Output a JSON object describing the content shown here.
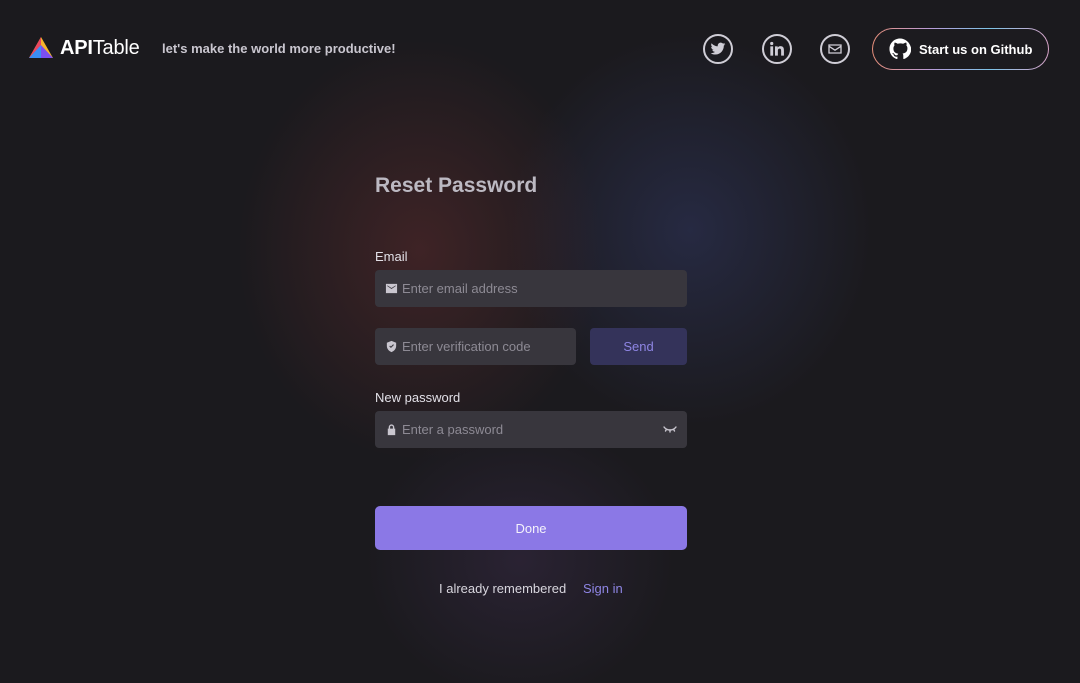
{
  "header": {
    "brand_bold": "API",
    "brand_light": "Table",
    "tagline": "let's make the world more productive!",
    "github_label": "Start us on Github"
  },
  "icons": {
    "logo": "apitable-logo",
    "twitter": "twitter-icon",
    "linkedin": "linkedin-icon",
    "email": "mail-icon",
    "github": "github-icon",
    "email_field": "envelope-icon",
    "code_field": "shield-icon",
    "password_field": "lock-icon",
    "password_toggle": "closed-eye-icon"
  },
  "form": {
    "title": "Reset Password",
    "email_label": "Email",
    "email_placeholder": "Enter email address",
    "code_placeholder": "Enter verification code",
    "send_label": "Send",
    "password_label": "New password",
    "password_placeholder": "Enter a password",
    "done_label": "Done",
    "footer_text": "I already remembered",
    "signin_label": "Sign in"
  },
  "colors": {
    "accent": "#8b78e6",
    "link": "#8e85e4",
    "background": "#1b1a1e",
    "field": "#38363d"
  }
}
